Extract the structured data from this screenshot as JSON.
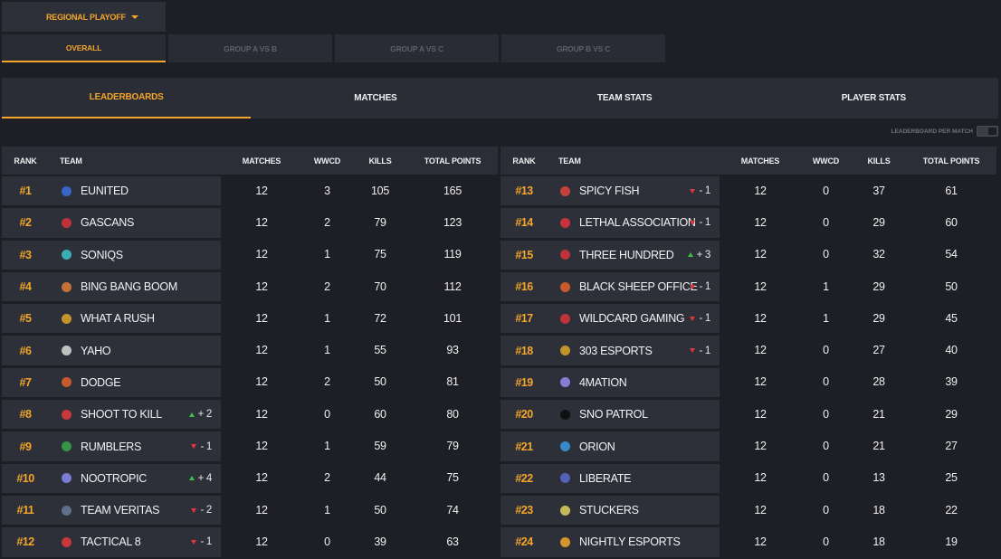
{
  "phase_select": {
    "label": "REGIONAL PLAYOFF"
  },
  "group_tabs": [
    {
      "label": "OVERALL",
      "active": true
    },
    {
      "label": "GROUP A VS B",
      "active": false
    },
    {
      "label": "GROUP A VS C",
      "active": false
    },
    {
      "label": "GROUP B VS C",
      "active": false
    }
  ],
  "main_tabs": [
    {
      "label": "LEADERBOARDS",
      "active": true
    },
    {
      "label": "MATCHES",
      "active": false
    },
    {
      "label": "TEAM STATS",
      "active": false
    },
    {
      "label": "PLAYER STATS",
      "active": false
    }
  ],
  "toggle": {
    "label": "LEADERBOARD PER MATCH",
    "on": false
  },
  "columns": {
    "rank": "RANK",
    "team": "TEAM",
    "matches": "MATCHES",
    "wwcd": "WWCD",
    "kills": "KILLS",
    "points": "TOTAL POINTS"
  },
  "colors": {
    "accent": "#f4a62a",
    "up": "#3fbf4a",
    "down": "#e2343b",
    "panel": "#2d3039"
  },
  "left_rows": [
    {
      "rank": "#1",
      "team": "EUNITED",
      "logo": "eunited-logo",
      "logo_color": "#3b6fe0",
      "change": "",
      "dir": "",
      "matches": "12",
      "wwcd": "3",
      "kills": "105",
      "points": "165"
    },
    {
      "rank": "#2",
      "team": "GASCANS",
      "logo": "gascans-logo",
      "logo_color": "#d8333a",
      "change": "",
      "dir": "",
      "matches": "12",
      "wwcd": "2",
      "kills": "79",
      "points": "123"
    },
    {
      "rank": "#3",
      "team": "SONIQS",
      "logo": "soniqs-logo",
      "logo_color": "#3cc3c9",
      "change": "",
      "dir": "",
      "matches": "12",
      "wwcd": "1",
      "kills": "75",
      "points": "119"
    },
    {
      "rank": "#4",
      "team": "BING BANG BOOM",
      "logo": "bing-bang-boom-logo",
      "logo_color": "#e07a3a",
      "change": "",
      "dir": "",
      "matches": "12",
      "wwcd": "2",
      "kills": "70",
      "points": "112"
    },
    {
      "rank": "#5",
      "team": "WHAT A RUSH",
      "logo": "what-a-rush-logo",
      "logo_color": "#e0a52a",
      "change": "",
      "dir": "",
      "matches": "12",
      "wwcd": "1",
      "kills": "72",
      "points": "101"
    },
    {
      "rank": "#6",
      "team": "YAHO",
      "logo": "yaho-logo",
      "logo_color": "#d9d9d9",
      "change": "",
      "dir": "",
      "matches": "12",
      "wwcd": "1",
      "kills": "55",
      "points": "93"
    },
    {
      "rank": "#7",
      "team": "DODGE",
      "logo": "dodge-logo",
      "logo_color": "#e0622a",
      "change": "",
      "dir": "",
      "matches": "12",
      "wwcd": "2",
      "kills": "50",
      "points": "81"
    },
    {
      "rank": "#8",
      "team": "SHOOT TO KILL",
      "logo": "shoot-to-kill-logo",
      "logo_color": "#e23a3a",
      "change": "+ 2",
      "dir": "up",
      "matches": "12",
      "wwcd": "0",
      "kills": "60",
      "points": "80"
    },
    {
      "rank": "#9",
      "team": "RUMBLERS",
      "logo": "rumblers-logo",
      "logo_color": "#3aa54a",
      "change": "- 1",
      "dir": "down",
      "matches": "12",
      "wwcd": "1",
      "kills": "59",
      "points": "79"
    },
    {
      "rank": "#10",
      "team": "NOOTROPIC",
      "logo": "nootropic-logo",
      "logo_color": "#8a8af0",
      "change": "+ 4",
      "dir": "up",
      "matches": "12",
      "wwcd": "2",
      "kills": "44",
      "points": "75"
    },
    {
      "rank": "#11",
      "team": "TEAM VERITAS",
      "logo": "team-veritas-logo",
      "logo_color": "#6a7a9a",
      "change": "- 2",
      "dir": "down",
      "matches": "12",
      "wwcd": "1",
      "kills": "50",
      "points": "74"
    },
    {
      "rank": "#12",
      "team": "TACTICAL 8",
      "logo": "tactical-8-logo",
      "logo_color": "#e23a3a",
      "change": "- 1",
      "dir": "down",
      "matches": "12",
      "wwcd": "0",
      "kills": "39",
      "points": "63"
    }
  ],
  "right_rows": [
    {
      "rank": "#13",
      "team": "SPICY FISH",
      "logo": "spicy-fish-logo",
      "logo_color": "#e2443a",
      "change": "- 1",
      "dir": "down",
      "matches": "12",
      "wwcd": "0",
      "kills": "37",
      "points": "61"
    },
    {
      "rank": "#14",
      "team": "LETHAL ASSOCIATION",
      "logo": "lethal-association-logo",
      "logo_color": "#e2343b",
      "change": "- 1",
      "dir": "down",
      "matches": "12",
      "wwcd": "0",
      "kills": "29",
      "points": "60"
    },
    {
      "rank": "#15",
      "team": "THREE HUNDRED",
      "logo": "three-hundred-logo",
      "logo_color": "#d8333a",
      "change": "+ 3",
      "dir": "up",
      "matches": "12",
      "wwcd": "0",
      "kills": "32",
      "points": "54"
    },
    {
      "rank": "#16",
      "team": "BLACK SHEEP OFFICE",
      "logo": "black-sheep-office-logo",
      "logo_color": "#e0622a",
      "change": "- 1",
      "dir": "down",
      "matches": "12",
      "wwcd": "1",
      "kills": "29",
      "points": "50"
    },
    {
      "rank": "#17",
      "team": "WILDCARD GAMING",
      "logo": "wildcard-gaming-logo",
      "logo_color": "#d8333a",
      "change": "- 1",
      "dir": "down",
      "matches": "12",
      "wwcd": "1",
      "kills": "29",
      "points": "45"
    },
    {
      "rank": "#18",
      "team": "303 ESPORTS",
      "logo": "303-esports-logo",
      "logo_color": "#e0a52a",
      "change": "- 1",
      "dir": "down",
      "matches": "12",
      "wwcd": "0",
      "kills": "27",
      "points": "40"
    },
    {
      "rank": "#19",
      "team": "4MATION",
      "logo": "4mation-logo",
      "logo_color": "#9a8af0",
      "change": "",
      "dir": "",
      "matches": "12",
      "wwcd": "0",
      "kills": "28",
      "points": "39"
    },
    {
      "rank": "#20",
      "team": "SNO PATROL",
      "logo": "sno-patrol-logo",
      "logo_color": "#0a0a0a",
      "change": "",
      "dir": "",
      "matches": "12",
      "wwcd": "0",
      "kills": "21",
      "points": "29"
    },
    {
      "rank": "#21",
      "team": "ORION",
      "logo": "orion-logo",
      "logo_color": "#3a9ae0",
      "change": "",
      "dir": "",
      "matches": "12",
      "wwcd": "0",
      "kills": "21",
      "points": "27"
    },
    {
      "rank": "#22",
      "team": "LIBERATE",
      "logo": "liberate-logo",
      "logo_color": "#5a6ad0",
      "change": "",
      "dir": "",
      "matches": "12",
      "wwcd": "0",
      "kills": "13",
      "points": "25"
    },
    {
      "rank": "#23",
      "team": "STUCKERS",
      "logo": "stuckers-logo",
      "logo_color": "#e0d060",
      "change": "",
      "dir": "",
      "matches": "12",
      "wwcd": "0",
      "kills": "18",
      "points": "22"
    },
    {
      "rank": "#24",
      "team": "NIGHTLY ESPORTS",
      "logo": "nightly-esports-logo",
      "logo_color": "#f4a62a",
      "change": "",
      "dir": "",
      "matches": "12",
      "wwcd": "0",
      "kills": "18",
      "points": "19"
    }
  ]
}
